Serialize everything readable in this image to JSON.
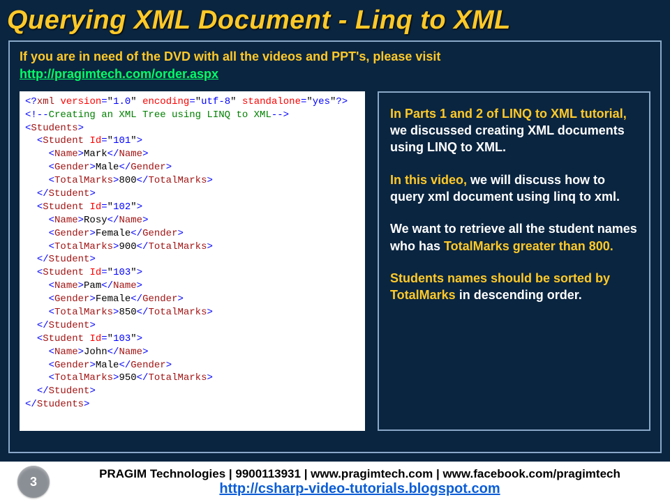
{
  "title": "Querying XML Document - Linq to XML",
  "intro": {
    "line1": "If you are in need of the DVD with all the videos and PPT's, please visit",
    "link": "http://pragimtech.com/order.aspx"
  },
  "chart_data": {
    "type": "table",
    "title": "Students XML sample data",
    "columns": [
      "Id",
      "Name",
      "Gender",
      "TotalMarks"
    ],
    "rows": [
      {
        "Id": "101",
        "Name": "Mark",
        "Gender": "Male",
        "TotalMarks": 800
      },
      {
        "Id": "102",
        "Name": "Rosy",
        "Gender": "Female",
        "TotalMarks": 900
      },
      {
        "Id": "103",
        "Name": "Pam",
        "Gender": "Female",
        "TotalMarks": 850
      },
      {
        "Id": "103",
        "Name": "John",
        "Gender": "Male",
        "TotalMarks": 950
      }
    ],
    "xml_declaration": "<?xml version=\"1.0\" encoding=\"utf-8\" standalone=\"yes\"?>",
    "xml_comment": "Creating an XML Tree using LINQ to XML",
    "root_element": "Students",
    "record_element": "Student"
  },
  "description": {
    "p1_hl": "In Parts 1 and 2 of LINQ to XML tutorial,",
    "p1_rest": " we discussed creating XML documents using LINQ to XML.",
    "p2_hl": "In this video,",
    "p2_rest": " we will discuss how to query xml document using linq to xml.",
    "p3_pre": "We want to retrieve all the student names who has ",
    "p3_hl": "TotalMarks greater than 800.",
    "p4_hl": "Students names should be sorted by TotalMarks",
    "p4_rest": " in descending order."
  },
  "footer": {
    "page": "3",
    "org": "PRAGIM Technologies | 9900113931 | www.pragimtech.com | www.facebook.com/pragimtech",
    "link": "http://csharp-video-tutorials.blogspot.com"
  },
  "tok": {
    "lt": "<",
    "gt": ">",
    "sl": "/",
    "q": "\"",
    "qm": "?",
    "bang": "!",
    "dash": "-",
    "eq": "=",
    "sp": " "
  },
  "xmlkw": {
    "xml": "xml",
    "version": "version",
    "v1": "1.0",
    "encoding": "encoding",
    "utf8": "utf-8",
    "standalone": "standalone",
    "yes": "yes",
    "Id": "Id"
  }
}
